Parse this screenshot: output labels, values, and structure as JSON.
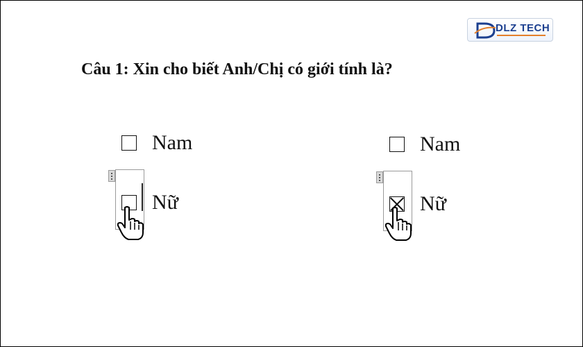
{
  "logo": {
    "text": "DLZ TECH",
    "icon": "dlz-logo-mark"
  },
  "question": "Câu 1: Xin cho biết Anh/Chị có giới tính là?",
  "forms": [
    {
      "options": [
        {
          "label": "Nam",
          "checked": false
        },
        {
          "label": "Nữ",
          "checked": false
        }
      ]
    },
    {
      "options": [
        {
          "label": "Nam",
          "checked": false
        },
        {
          "label": "Nữ",
          "checked": true
        }
      ]
    }
  ],
  "icons": {
    "control_handle": "drag-handle-icon",
    "pointer": "hand-pointer-icon"
  }
}
